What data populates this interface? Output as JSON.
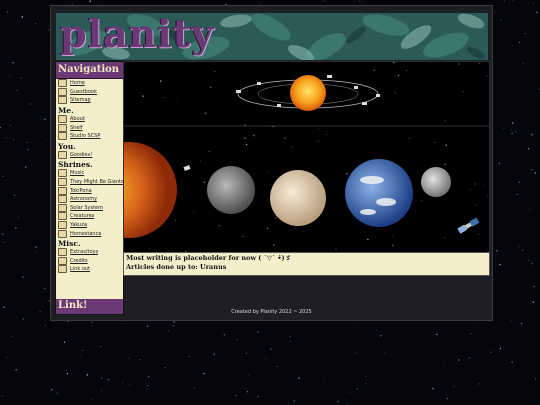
{
  "site": {
    "title": "planity"
  },
  "nav": {
    "heading": "Navigation",
    "sections": [
      {
        "title": "",
        "items": [
          "Home",
          "Guestbook",
          "Sitemap"
        ]
      },
      {
        "title": "Me.",
        "items": [
          "About",
          "Shelf",
          "Studio SCSP"
        ]
      },
      {
        "title": "You.",
        "items": [
          "Goodies!"
        ]
      },
      {
        "title": "Shrines.",
        "items": [
          "Music",
          "They Might Be Giants",
          "TokiPona",
          "Astronomy",
          "Solar System",
          "Creatures",
          "Yakuza",
          "Homestance"
        ]
      },
      {
        "title": "Misc.",
        "items": [
          "Extras/toys",
          "Credits",
          "Link out"
        ]
      }
    ],
    "footer": "Link!"
  },
  "main": {
    "note_line1": "Most writing is placeholder for now (   ˙▽˙  •̀)ゞ",
    "note_line2": "Articles done up to: Uranus"
  },
  "footer": {
    "text": "Created by Planity 2022 ~ 2025"
  },
  "colors": {
    "accent": "#6b3a76",
    "panel": "#f4eecb",
    "banner": "#2c5a58"
  }
}
